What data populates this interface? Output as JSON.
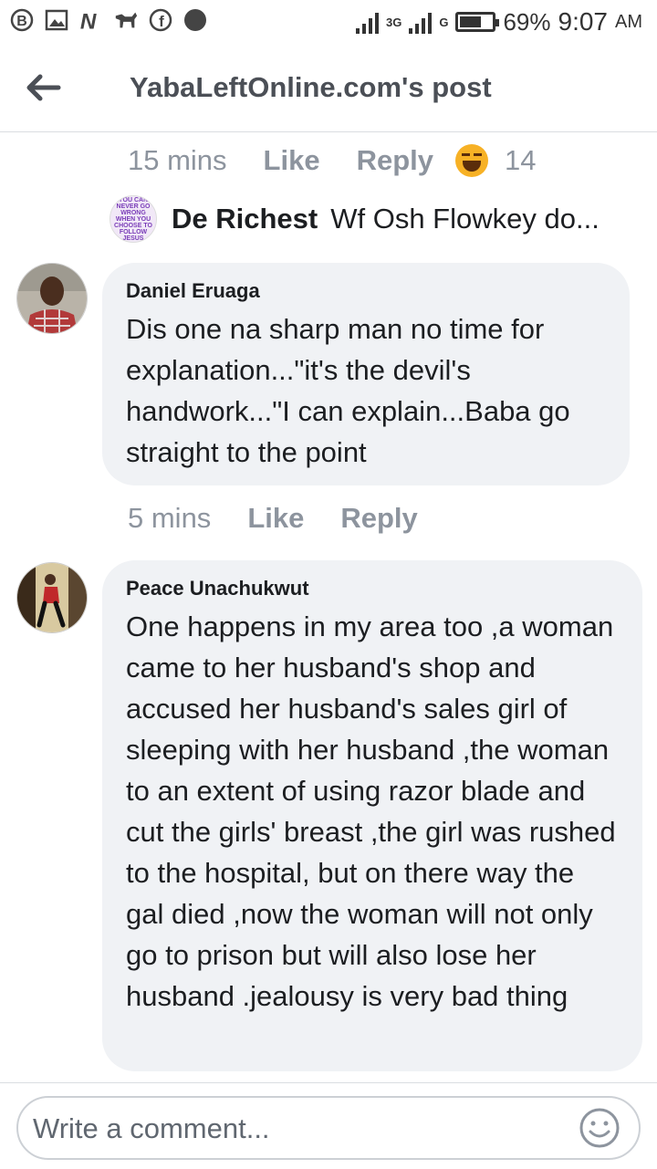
{
  "status_bar": {
    "network_label": "3G",
    "network2_label": "G",
    "battery_percent": "69%",
    "battery_level": 0.69,
    "time": "9:07",
    "ampm": "AM"
  },
  "header": {
    "title": "YabaLeftOnline.com's post"
  },
  "prev_comment_meta": {
    "time": "15 mins",
    "like_label": "Like",
    "reply_label": "Reply",
    "reaction_icon": "haha-emoji-icon",
    "reaction_count": "14"
  },
  "reply_preview": {
    "avatar_text": "YOU CAN NEVER GO WRONG WHEN YOU CHOOSE TO FOLLOW JESUS",
    "name": "De Richest",
    "text": "Wf Osh Flowkey do..."
  },
  "comments": [
    {
      "name": "Daniel Eruaga",
      "text": "Dis one na sharp man no time for explanation...\"it's the devil's handwork...\"I can explain...Baba go straight to the point",
      "time": "5 mins",
      "like_label": "Like",
      "reply_label": "Reply"
    },
    {
      "name": "Peace Unachukwut",
      "text": "One happens in my area too ,a woman came to her husband's shop and accused her husband's sales girl of sleeping with her husband ,the woman to an extent of using razor blade and cut the girls' breast ,the girl was rushed to the hospital, but on there way the gal died ,now the woman will not only go to prison but will also lose her husband .jealousy is very bad thing"
    }
  ],
  "composer": {
    "placeholder": "Write a comment...",
    "emoji_icon": "smiley-icon"
  },
  "colors": {
    "bubble": "#f0f2f5",
    "meta_text": "#8d949e",
    "header_text": "#4b4f56"
  }
}
